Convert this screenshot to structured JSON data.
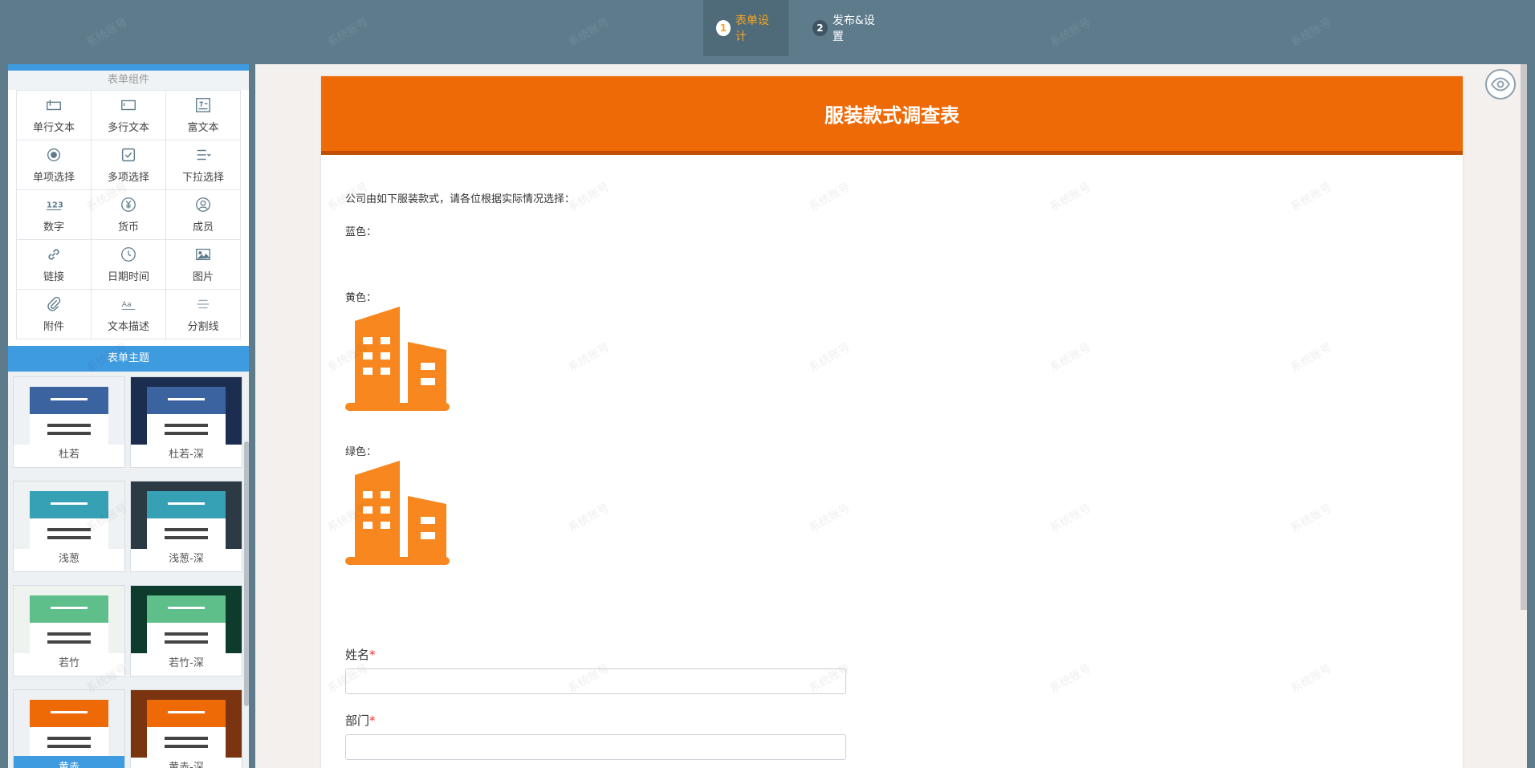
{
  "steps": [
    {
      "num": "1",
      "label": "表单设计"
    },
    {
      "num": "2",
      "label": "发布&设置"
    }
  ],
  "watermark": "系统账号",
  "left_panel": {
    "components_title": "表单组件",
    "components": [
      {
        "label": "单行文本",
        "icon": "single-line-text-icon"
      },
      {
        "label": "多行文本",
        "icon": "multi-line-text-icon"
      },
      {
        "label": "富文本",
        "icon": "rich-text-icon"
      },
      {
        "label": "单项选择",
        "icon": "radio-icon"
      },
      {
        "label": "多项选择",
        "icon": "checkbox-icon"
      },
      {
        "label": "下拉选择",
        "icon": "dropdown-list-icon"
      },
      {
        "label": "数字",
        "icon": "number-icon"
      },
      {
        "label": "货币",
        "icon": "currency-icon"
      },
      {
        "label": "成员",
        "icon": "member-icon"
      },
      {
        "label": "链接",
        "icon": "link-icon"
      },
      {
        "label": "日期时间",
        "icon": "clock-icon"
      },
      {
        "label": "图片",
        "icon": "image-icon"
      },
      {
        "label": "附件",
        "icon": "paperclip-icon"
      },
      {
        "label": "文本描述",
        "icon": "text-description-icon"
      },
      {
        "label": "分割线",
        "icon": "divider-icon"
      }
    ],
    "theme_title": "表单主题",
    "themes": [
      {
        "name": "杜若",
        "band": "#3a63a0",
        "bg": "#eef1f6"
      },
      {
        "name": "杜若-深",
        "band": "#3a63a0",
        "bg": "#1b2e4f"
      },
      {
        "name": "浅葱",
        "band": "#36a1b5",
        "bg": "#eef2f3"
      },
      {
        "name": "浅葱-深",
        "band": "#36a1b5",
        "bg": "#2b3a44"
      },
      {
        "name": "若竹",
        "band": "#5ebf8a",
        "bg": "#eef3ef"
      },
      {
        "name": "若竹-深",
        "band": "#5ebf8a",
        "bg": "#0d3b2c"
      },
      {
        "name": "黄赤",
        "band": "#ee6a06",
        "bg": "#eef1f3",
        "selected": true
      },
      {
        "name": "黄赤-深",
        "band": "#ee6a06",
        "bg": "#7a3510"
      }
    ]
  },
  "form": {
    "title": "服装款式调查表",
    "description": "公司由如下服装款式，请各位根据实际情况选择：",
    "options": [
      {
        "label": "蓝色：",
        "has_image": false
      },
      {
        "label": "黄色：",
        "has_image": true
      },
      {
        "label": "绿色：",
        "has_image": true
      }
    ],
    "fields": [
      {
        "label": "姓名",
        "required": "*"
      },
      {
        "label": "部门",
        "required": "*"
      }
    ],
    "accent": "#ee6a06"
  }
}
